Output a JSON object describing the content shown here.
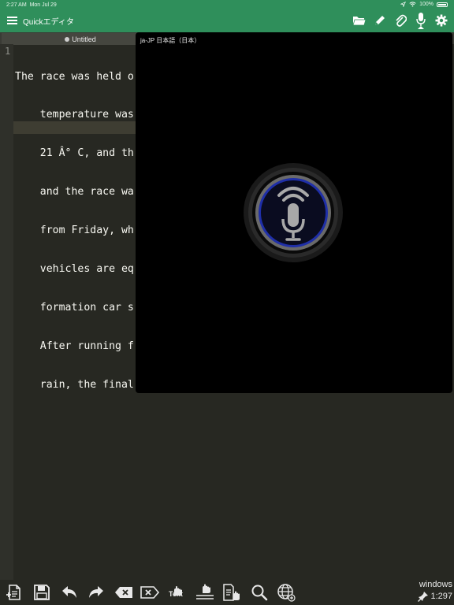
{
  "status": {
    "time": "2:27 AM",
    "date": "Mon Jul 29",
    "battery": "100%"
  },
  "app": {
    "title": "Quickエディタ"
  },
  "nav_icons": [
    "folder-icon",
    "pencil-icon",
    "paperclip-icon",
    "microphone-icon",
    "gear-icon"
  ],
  "tab": {
    "label": "Untitled"
  },
  "editor": {
    "line_number": "1",
    "lines": [
      "The race was held o",
      "    temperature was",
      "    21 Â° C, and th",
      "    and the race wa",
      "    from Friday, wh",
      "    vehicles are eq",
      "    formation car s",
      "    After running f",
      "    rain, the final"
    ]
  },
  "speech_popup": {
    "language": "ja-JP 日本語（日本）"
  },
  "toolbar": {
    "text_label": "Text",
    "buttons": [
      "new-file-icon",
      "save-icon",
      "undo-icon",
      "redo-icon",
      "delete-backward-icon",
      "delete-forward-icon",
      "text-hand-icon",
      "line-hand-icon",
      "copy-hand-icon",
      "search-icon",
      "globe-icon"
    ]
  },
  "footer": {
    "line_ending": "windows",
    "cursor": "1:297"
  },
  "colors": {
    "accent": "#2f8f5b",
    "editor_bg": "#272822",
    "editor_text": "#f8f8f2",
    "mic_ring": "#1f2fa8"
  }
}
